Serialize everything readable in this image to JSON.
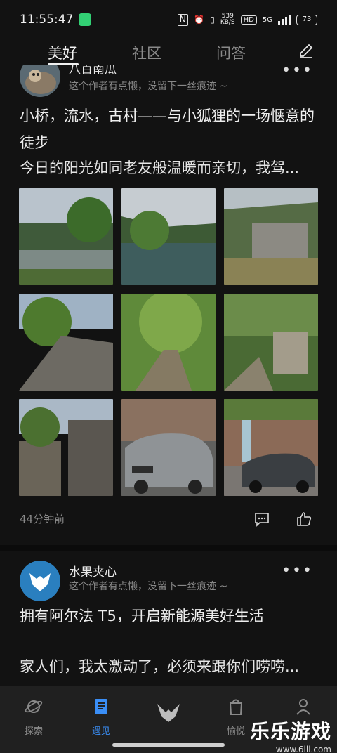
{
  "status_bar": {
    "time": "11:55:47",
    "network_speed": "539",
    "network_unit": "KB/S",
    "hd": "HD",
    "signal": "5G",
    "battery": "73"
  },
  "top_tabs": [
    "美好",
    "社区",
    "问答"
  ],
  "posts": [
    {
      "author": "八百南瓜",
      "author_sub": "这个作者有点懒，没留下一丝痕迹 ~",
      "title": "小桥，流水，古村——与小狐狸的一场惬意的徒步",
      "excerpt": "今日的阳光如同老友般温暖而亲切，我驾...",
      "time": "44分钟前"
    },
    {
      "author": "水果夹心",
      "author_sub": "这个作者有点懒，没留下一丝痕迹 ~",
      "title": "拥有阿尔法 T5，开启新能源美好生活",
      "excerpt": "家人们，我太激动了，必须来跟你们唠唠..."
    }
  ],
  "bottom_nav": [
    {
      "label": "探索",
      "icon": "planet-icon"
    },
    {
      "label": "遇见",
      "icon": "article-icon"
    },
    {
      "label": "",
      "icon": "brand-logo-icon"
    },
    {
      "label": "愉悦",
      "icon": "bag-icon"
    },
    {
      "label": "",
      "icon": "profile-icon"
    }
  ],
  "watermark": {
    "title": "乐乐游戏",
    "url": "www.6lll.com"
  },
  "colors": {
    "background": "#121212",
    "accent": "#3a8ef6",
    "nav_bg": "#202020"
  }
}
